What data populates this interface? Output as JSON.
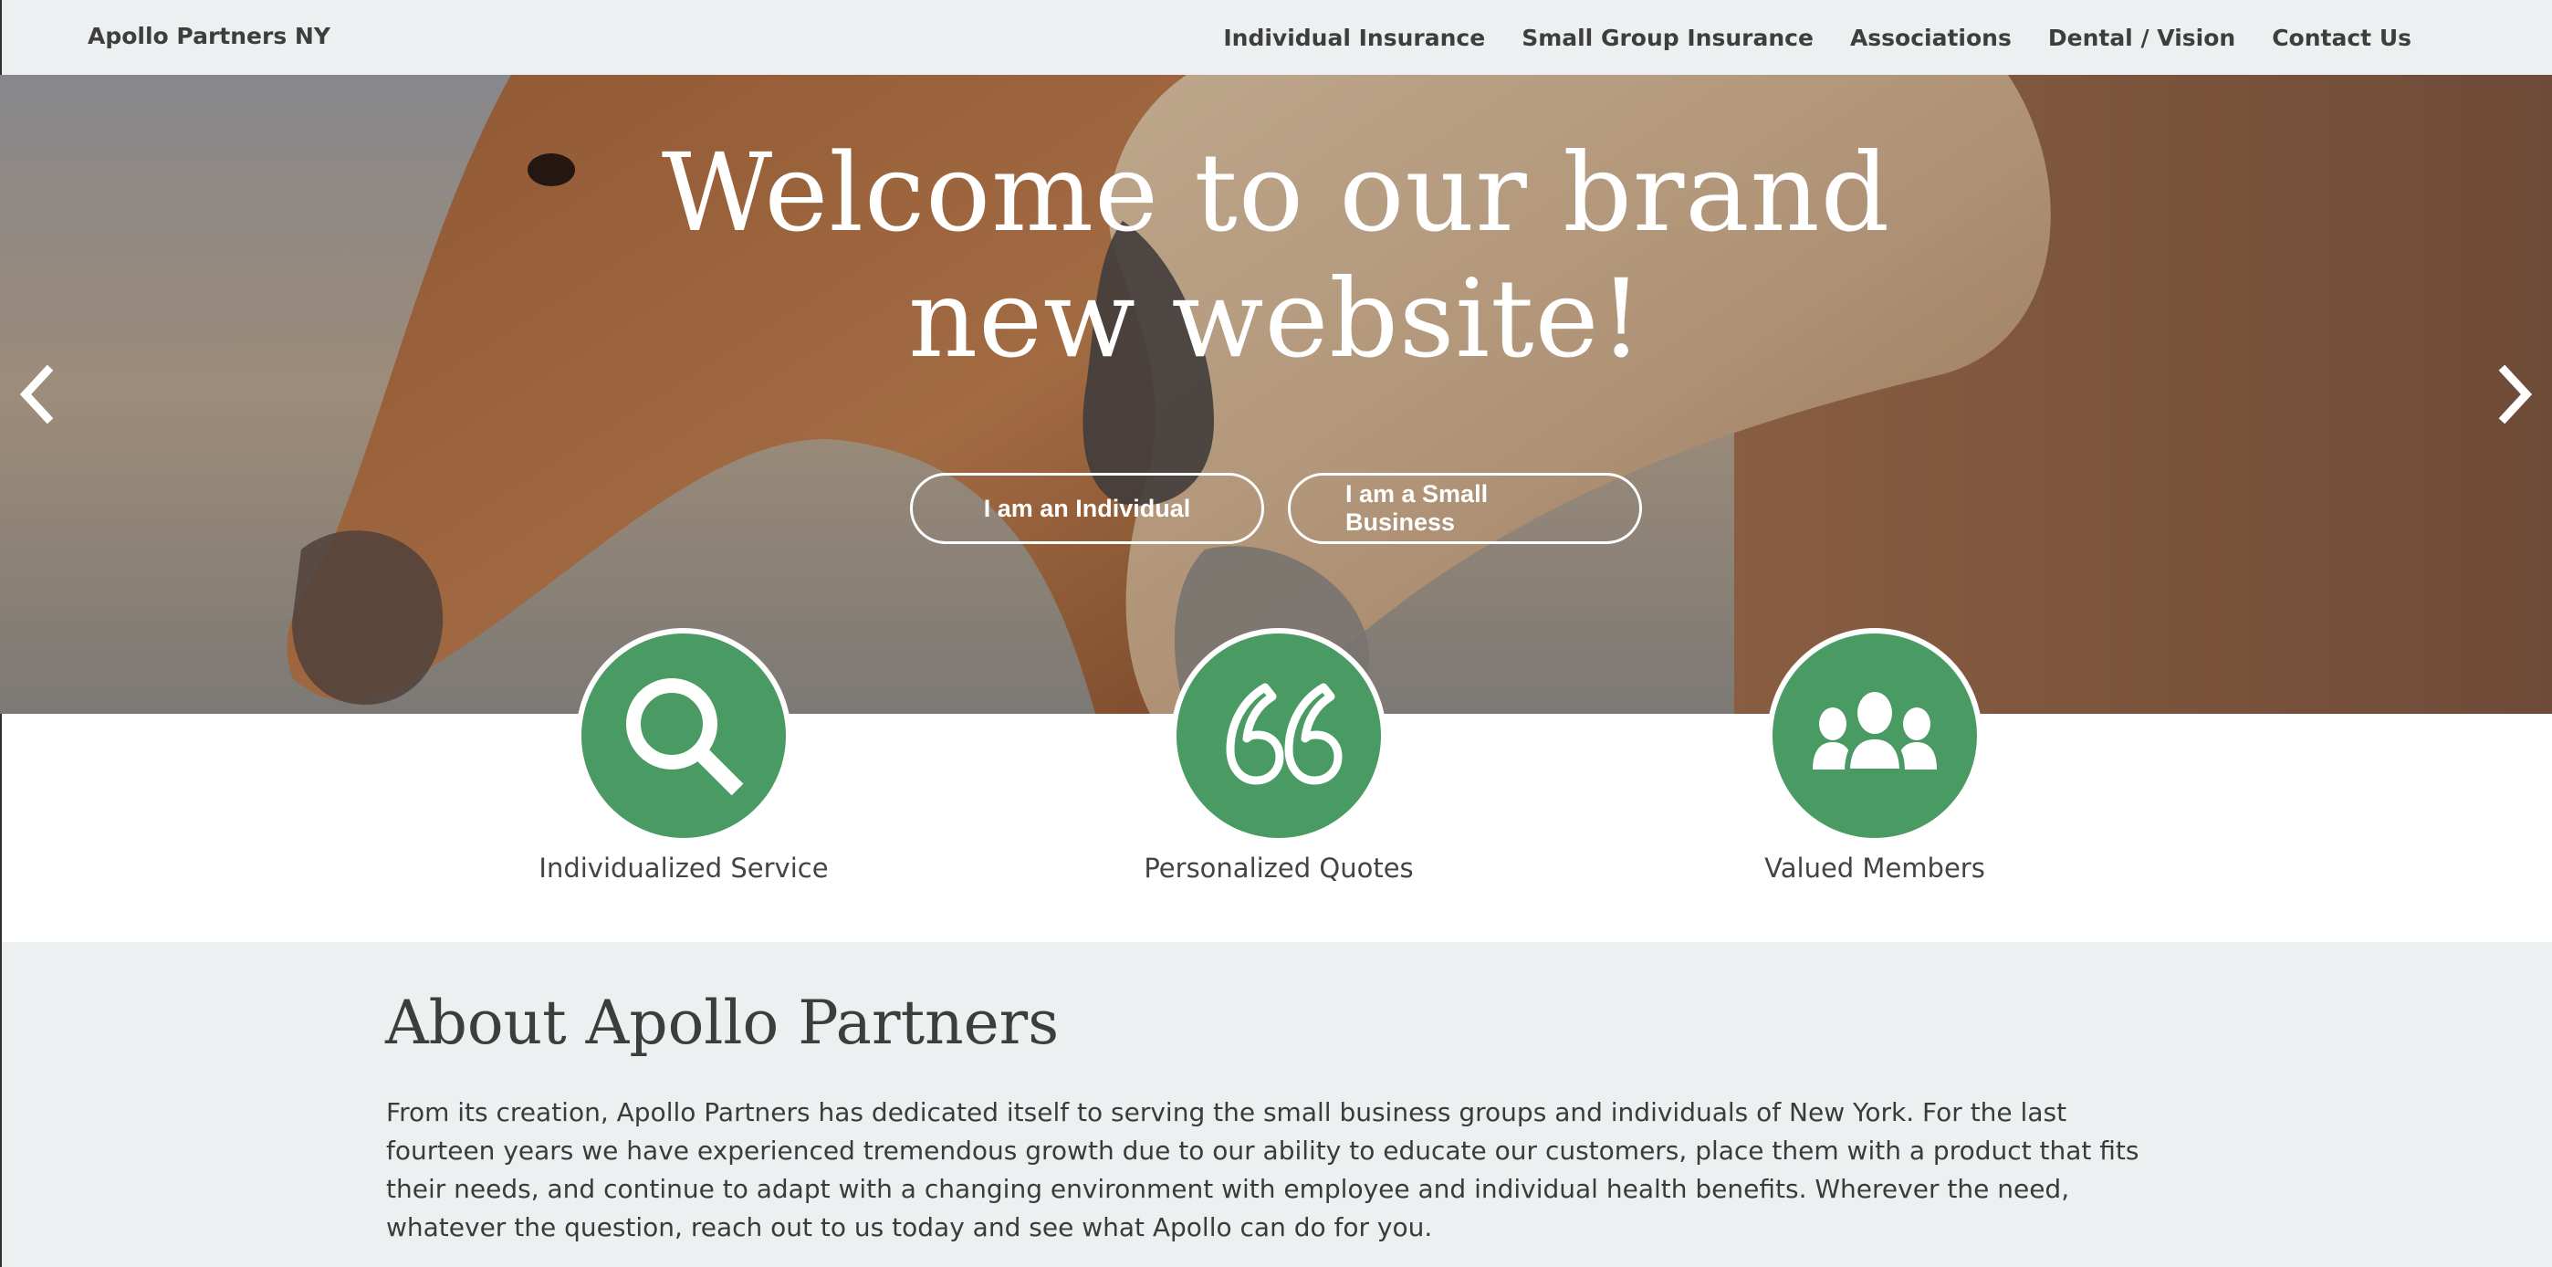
{
  "navbar": {
    "brand": "Apollo Partners NY",
    "links": [
      "Individual Insurance",
      "Small Group Insurance",
      "Associations",
      "Dental / Vision",
      "Contact Us"
    ]
  },
  "hero": {
    "title_line1": "Welcome to our brand",
    "title_line2": "new website!",
    "btn_individual": "I am an Individual",
    "btn_business": "I am a Small Business",
    "prev_icon": "chevron-left-icon",
    "next_icon": "chevron-right-icon"
  },
  "features": [
    {
      "icon": "search-icon",
      "label": "Individualized Service"
    },
    {
      "icon": "quote-icon",
      "label": "Personalized Quotes"
    },
    {
      "icon": "group-icon",
      "label": "Valued Members"
    }
  ],
  "about": {
    "title": "About Apollo Partners",
    "text": "From its creation, Apollo Partners has dedicated itself to serving the small business groups and individuals of New York. For the last fourteen years we have experienced tremendous growth due to our ability to educate our customers, place them with a product that fits their needs, and continue to adapt with a changing environment with employee and individual health benefits. Wherever the need, whatever the question, reach out to us today and see what Apollo can do for you."
  },
  "colors": {
    "accent_green": "#4a9a63",
    "nav_background": "#ecf0f1",
    "text_dark": "#3e3e3e"
  }
}
